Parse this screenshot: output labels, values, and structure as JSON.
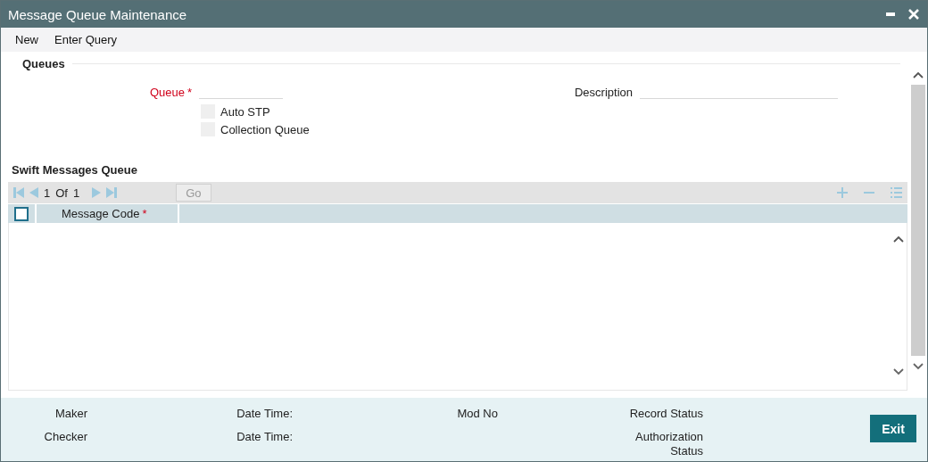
{
  "window": {
    "title": "Message Queue Maintenance"
  },
  "menu": [
    {
      "label": "New"
    },
    {
      "label": "Enter Query"
    }
  ],
  "queues": {
    "title": "Queues",
    "queue": {
      "label": "Queue",
      "required_mark": "*"
    },
    "description": {
      "label": "Description"
    },
    "options": [
      {
        "label": "Auto STP",
        "checked": false
      },
      {
        "label": "Collection Queue",
        "checked": false
      }
    ]
  },
  "grid": {
    "title": "Swift Messages Queue",
    "pager": {
      "current": "1",
      "of": "Of",
      "total": "1"
    },
    "go": "Go",
    "header_checked": false,
    "columns": [
      {
        "label": "Message Code",
        "required_mark": "*"
      }
    ]
  },
  "footer": {
    "columns": [
      [
        "Maker",
        "Checker"
      ],
      [
        "Date Time:",
        "Date Time:"
      ],
      [
        "Mod No"
      ],
      [
        "Record Status",
        "Authorization Status"
      ]
    ],
    "exit": "Exit"
  }
}
